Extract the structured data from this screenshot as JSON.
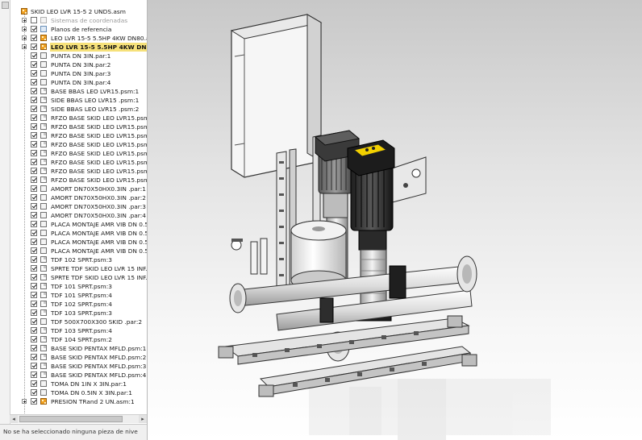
{
  "tree": {
    "root": "SKID LEO LVR 15-5 2 UNDS.asm",
    "items": [
      {
        "label": "Sistemas de coordenadas",
        "icon": "coords",
        "checked": false,
        "expander": true,
        "dim": true
      },
      {
        "label": "Planos de referencia",
        "icon": "planes",
        "checked": true,
        "expander": true
      },
      {
        "label": "LEO LVR 15-5 5.5HP 4KW DN80.as",
        "icon": "asm",
        "checked": true,
        "expander": true
      },
      {
        "label": "LEO LVR 15-5 5.5HP 4KW DN80.a",
        "icon": "asm",
        "checked": true,
        "expander": true,
        "highlight": true
      },
      {
        "label": "PUNTA DN 3IN.par:1",
        "icon": "part",
        "checked": true
      },
      {
        "label": "PUNTA DN 3IN.par:2",
        "icon": "part",
        "checked": true
      },
      {
        "label": "PUNTA DN 3IN.par:3",
        "icon": "part",
        "checked": true
      },
      {
        "label": "PUNTA DN 3IN.par:4",
        "icon": "part",
        "checked": true
      },
      {
        "label": "BASE BBAS LEO LVR15.psm:1",
        "icon": "sheet",
        "checked": true
      },
      {
        "label": "SIDE BBAS LEO LVR15 .psm:1",
        "icon": "sheet",
        "checked": true
      },
      {
        "label": "SIDE BBAS LEO LVR15 .psm:2",
        "icon": "sheet",
        "checked": true
      },
      {
        "label": "RFZO BASE SKID LEO LVR15.psm:",
        "icon": "sheet",
        "checked": true
      },
      {
        "label": "RFZO BASE SKID LEO LVR15.psm:",
        "icon": "sheet",
        "checked": true
      },
      {
        "label": "RFZO BASE SKID LEO LVR15.psm:",
        "icon": "sheet",
        "checked": true
      },
      {
        "label": "RFZO BASE SKID LEO LVR15.psm:",
        "icon": "sheet",
        "checked": true
      },
      {
        "label": "RFZO BASE SKID LEO LVR15.psm:",
        "icon": "sheet",
        "checked": true
      },
      {
        "label": "RFZO BASE SKID LEO LVR15.psm:",
        "icon": "sheet",
        "checked": true
      },
      {
        "label": "RFZO BASE SKID LEO LVR15.psm:",
        "icon": "sheet",
        "checked": true
      },
      {
        "label": "RFZO BASE SKID LEO LVR15.psm:",
        "icon": "sheet",
        "checked": true
      },
      {
        "label": "AMORT DN70X50HX0.3IN .par:1",
        "icon": "part",
        "checked": true
      },
      {
        "label": "AMORT DN70X50HX0.3IN .par:2",
        "icon": "part",
        "checked": true
      },
      {
        "label": "AMORT DN70X50HX0.3IN .par:3",
        "icon": "part",
        "checked": true
      },
      {
        "label": "AMORT DN70X50HX0.3IN .par:4",
        "icon": "part",
        "checked": true
      },
      {
        "label": "PLACA MONTAJE AMR VIB DN 0.5",
        "icon": "part",
        "checked": true
      },
      {
        "label": "PLACA MONTAJE AMR VIB DN 0.5",
        "icon": "part",
        "checked": true
      },
      {
        "label": "PLACA MONTAJE AMR VIB DN 0.5",
        "icon": "part",
        "checked": true
      },
      {
        "label": "PLACA MONTAJE AMR VIB DN 0.5",
        "icon": "part",
        "checked": true
      },
      {
        "label": "TDF 102 SPRT.psm:3",
        "icon": "sheet",
        "checked": true
      },
      {
        "label": "SPRTE TDF SKID LEO LVR 15 INF.p",
        "icon": "sheet",
        "checked": true
      },
      {
        "label": "SPRTE TDF SKID LEO LVR 15 INF.p",
        "icon": "sheet",
        "checked": true
      },
      {
        "label": "TDF 101 SPRT.psm:3",
        "icon": "sheet",
        "checked": true
      },
      {
        "label": "TDF 101 SPRT.psm:4",
        "icon": "sheet",
        "checked": true
      },
      {
        "label": "TDF 102 SPRT.psm:4",
        "icon": "sheet",
        "checked": true
      },
      {
        "label": "TDF 103 SPRT.psm:3",
        "icon": "sheet",
        "checked": true
      },
      {
        "label": "TDF 500X700X300 SKID .par:2",
        "icon": "part",
        "checked": true
      },
      {
        "label": "TDF 103 SPRT.psm:4",
        "icon": "sheet",
        "checked": true
      },
      {
        "label": "TDF 104 SPRT.psm:2",
        "icon": "sheet",
        "checked": true
      },
      {
        "label": "BASE SKID PENTAX MFLD.psm:1",
        "icon": "sheet",
        "checked": true
      },
      {
        "label": "BASE SKID PENTAX MFLD.psm:2",
        "icon": "sheet",
        "checked": true
      },
      {
        "label": "BASE SKID PENTAX MFLD.psm:3",
        "icon": "sheet",
        "checked": true
      },
      {
        "label": "BASE SKID PENTAX MFLD.psm:4",
        "icon": "sheet",
        "checked": true
      },
      {
        "label": "TOMA DN 1IN X 3IN.par:1",
        "icon": "part",
        "checked": true
      },
      {
        "label": "TOMA DN 0.5IN X 3IN.par:1",
        "icon": "part",
        "checked": true
      },
      {
        "label": "PRESION TRand 2 UN.asm:1",
        "icon": "asm",
        "checked": true,
        "expander": true
      }
    ]
  },
  "status_text": "No se ha seleccionado ninguna pieza de nive",
  "colors": {
    "highlight": "#f6e17a",
    "assembly_icon": "#f0a020",
    "motor_cover": "#f2d000",
    "panel_bg": "#ffffff",
    "viewport_top": "#c8c8c8",
    "viewport_bottom": "#ffffff"
  },
  "icons": {
    "assembly": "assembly-icon",
    "part": "part-icon",
    "sheet_metal": "sheet-metal-icon",
    "planes": "reference-planes-icon",
    "coords": "coordinate-system-icon"
  }
}
